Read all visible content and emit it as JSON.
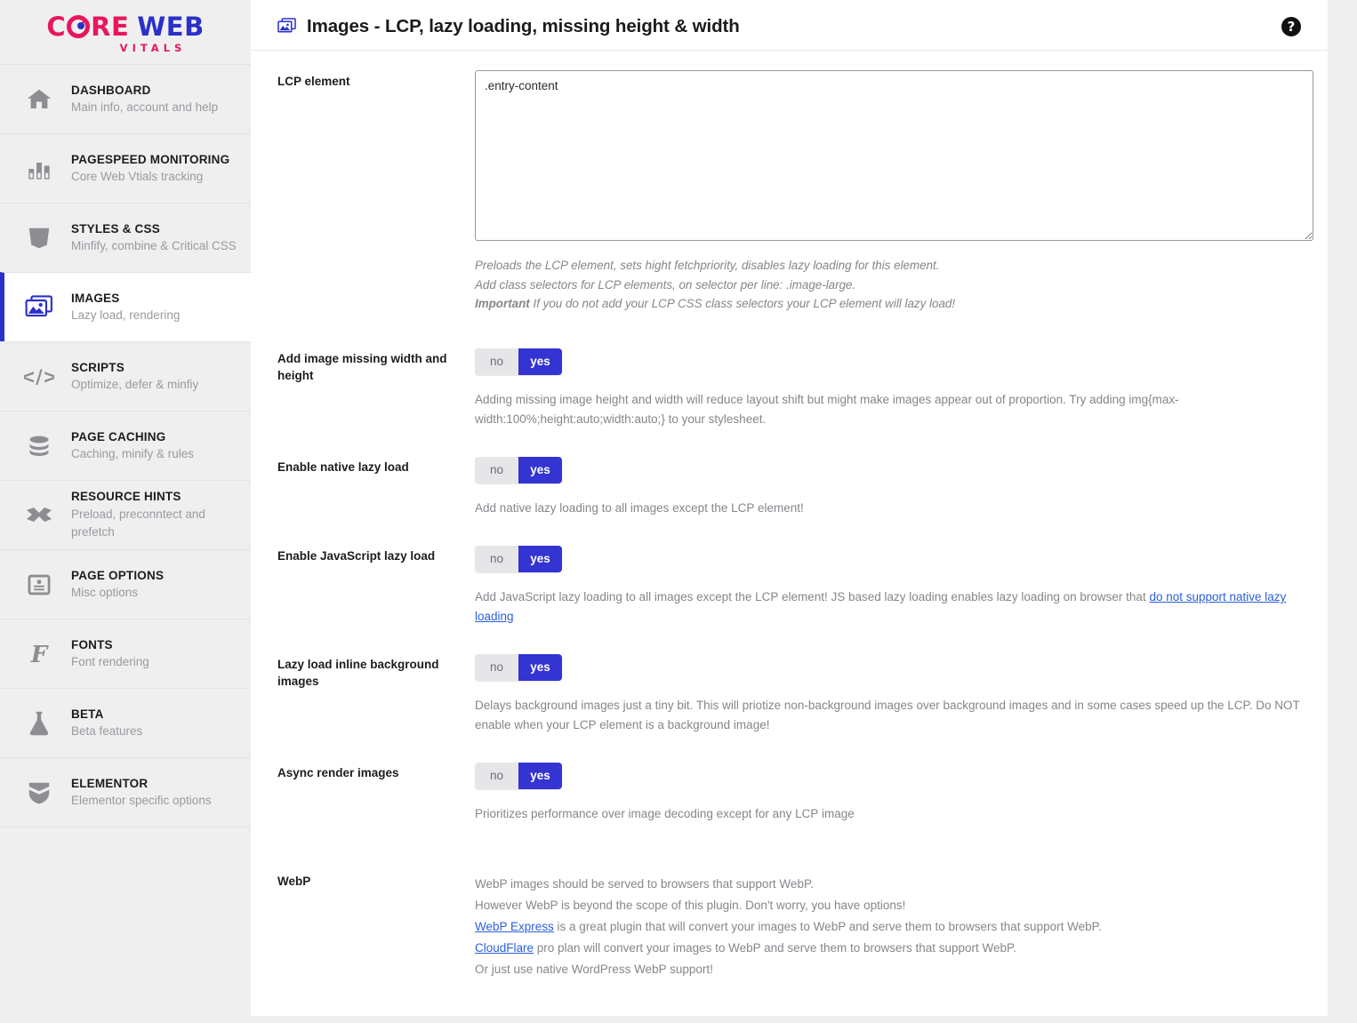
{
  "brand": {
    "name_core": "C RE",
    "name_core_part1": "C",
    "name_core_part2": "RE",
    "name_web": "WEB",
    "tagline": "VITALS",
    "pink": "#e8175d",
    "blue": "#2b30c9"
  },
  "sidebar": {
    "items": [
      {
        "title": "DASHBOARD",
        "subtitle": "Main info, account and help",
        "icon": "home-icon",
        "active": false
      },
      {
        "title": "PAGESPEED MONITORING",
        "subtitle": "Core Web Vtials tracking",
        "icon": "bar-chart-icon",
        "active": false
      },
      {
        "title": "STYLES & CSS",
        "subtitle": "Minfify, combine & Critical CSS",
        "icon": "css3-shield-icon",
        "active": false
      },
      {
        "title": "IMAGES",
        "subtitle": "Lazy load, rendering",
        "icon": "images-icon",
        "active": true
      },
      {
        "title": "SCRIPTS",
        "subtitle": "Optimize, defer & minfiy",
        "icon": "code-brackets-icon",
        "active": false
      },
      {
        "title": "PAGE CACHING",
        "subtitle": "Caching, minify & rules",
        "icon": "database-icon",
        "active": false
      },
      {
        "title": "RESOURCE HINTS",
        "subtitle": "Preload, preconntect and prefetch",
        "icon": "crossed-arrows-icon",
        "active": false
      },
      {
        "title": "PAGE OPTIONS",
        "subtitle": "Misc options",
        "icon": "id-card-icon",
        "active": false
      },
      {
        "title": "FONTS",
        "subtitle": "Font rendering",
        "icon": "font-f-icon",
        "active": false
      },
      {
        "title": "BETA",
        "subtitle": "Beta features",
        "icon": "flask-icon",
        "active": false
      },
      {
        "title": "ELEMENTOR",
        "subtitle": "Elementor specific options",
        "icon": "elementor-shield-icon",
        "active": false
      }
    ]
  },
  "header": {
    "title": "Images - LCP, lazy loading, missing height & width",
    "icon": "images-icon",
    "help_label": "?"
  },
  "settings": {
    "lcp": {
      "label": "LCP element",
      "value": ".entry-content",
      "placeholder": "",
      "hint_line1": "Preloads the LCP element, sets hight fetchpriority, disables lazy loading for this element.",
      "hint_line2": "Add class selectors for LCP elements, on selector per line: .image-large.",
      "hint_line3_bold": "Important",
      "hint_line3_rest": " If you do not add your LCP CSS class selectors your LCP element will lazy load!"
    },
    "toggle_options": {
      "off": "no",
      "on": "yes"
    },
    "missing_wh": {
      "label": "Add image missing width and height",
      "value": "yes",
      "description": "Adding missing image height and width will reduce layout shift but might make images appear out of proportion. Try adding img{max-width:100%;height:auto;width:auto;} to your stylesheet."
    },
    "native_lazy": {
      "label": "Enable native lazy load",
      "value": "yes",
      "description": "Add native lazy loading to all images except the LCP element!"
    },
    "js_lazy": {
      "label": "Enable JavaScript lazy load",
      "value": "yes",
      "description_before": "Add JavaScript lazy loading to all images except the LCP element! JS based lazy loading enables lazy loading on browser that ",
      "link_text": "do not support native lazy loading"
    },
    "inline_bg": {
      "label": "Lazy load inline background images",
      "value": "yes",
      "description": "Delays background images just a tiny bit. This will priotize non-background images over background images and in some cases speed up the LCP. Do NOT enable when your LCP element is a background image!"
    },
    "async_render": {
      "label": "Async render images",
      "value": "yes",
      "description": "Prioritizes performance over image decoding except for any LCP image"
    },
    "webp": {
      "label": "WebP",
      "line1": "WebP images should be served to browsers that support WebP.",
      "line2": "However WebP is beyond the scope of this plugin. Don't worry, you have options!",
      "line3_link": "WebP Express",
      "line3_rest": " is a great plugin that will convert your images to WebP and serve them to browsers that support WebP.",
      "line4_link": "CloudFlare",
      "line4_rest": " pro plan will convert your images to WebP and serve them to browsers that support WebP.",
      "line5": "Or just use native WordPress WebP support!"
    }
  },
  "colors": {
    "accent_blue": "#3434d2",
    "link_blue": "#2b5fd9",
    "sidebar_bg": "#efeff0",
    "panel_bg": "#ffffff"
  }
}
